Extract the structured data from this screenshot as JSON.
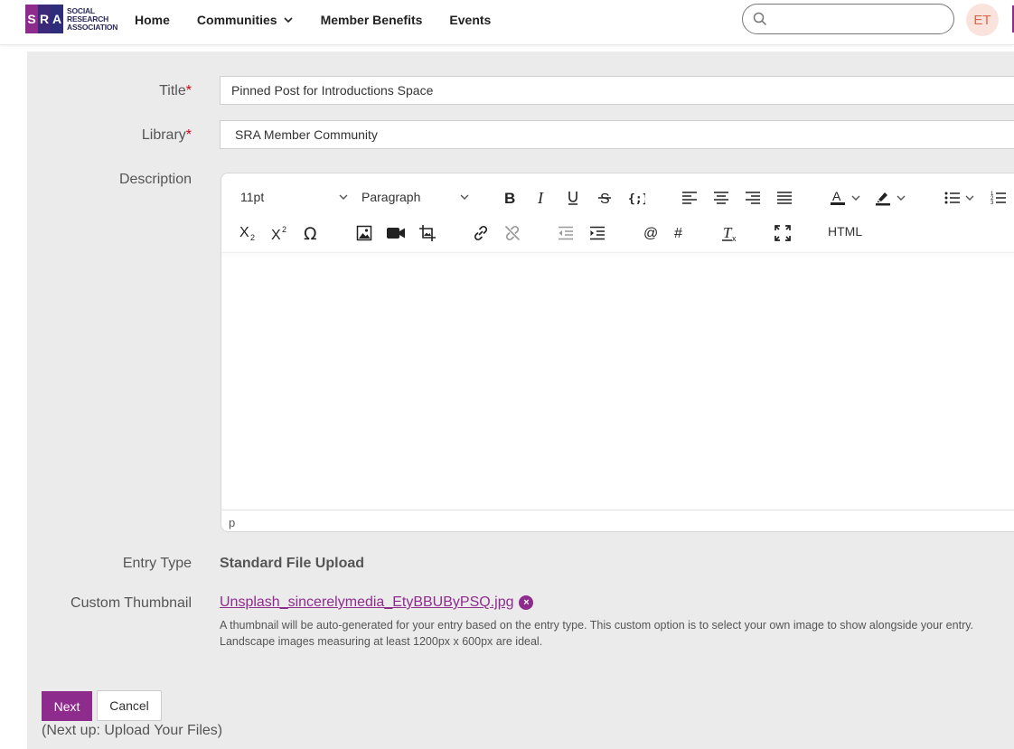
{
  "header": {
    "logo_letters": [
      "S",
      "R",
      "A"
    ],
    "logo_text_lines": [
      "SOCIAL",
      "RESEARCH",
      "ASSOCIATION"
    ],
    "nav": [
      {
        "label": "Home"
      },
      {
        "label": "Communities"
      },
      {
        "label": "Member Benefits"
      },
      {
        "label": "Events"
      }
    ],
    "search_placeholder": "",
    "avatar_initials": "ET"
  },
  "form": {
    "title_label": "Title",
    "title_value": "Pinned Post for Introductions Space",
    "library_label": "Library",
    "library_value": "SRA Member Community",
    "required_mark": "*",
    "description_label": "Description",
    "editor": {
      "font_size": "11pt",
      "block_format": "Paragraph",
      "html_button": "HTML",
      "status_path": "p"
    },
    "entry_type_label": "Entry Type",
    "entry_type_value": "Standard File Upload",
    "thumbnail_label": "Custom Thumbnail",
    "thumbnail_file": "Unsplash_sincerelymedia_EtyBBUByPSQ.jpg",
    "thumbnail_help_1": "A thumbnail will be auto-generated for your entry based on the entry type. This custom option is to select your own image to show alongside your entry.",
    "thumbnail_help_2": "Landscape images measuring at least 1200px x 600px are ideal.",
    "next_button": "Next",
    "cancel_button": "Cancel",
    "next_up": "(Next up: Upload Your Files)"
  },
  "colors": {
    "brand": "#8e2c8e",
    "panel_bg": "#ebebeb",
    "required": "#d0021b"
  }
}
